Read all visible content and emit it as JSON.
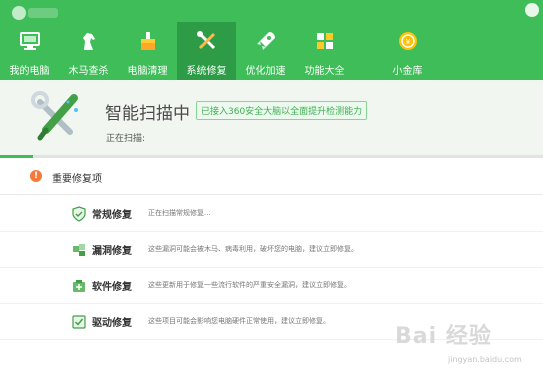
{
  "colors": {
    "accent": "#3fbd58",
    "active_tab": "#2e9c46",
    "warning": "#f27a3a"
  },
  "nav": {
    "items": [
      {
        "label": "我的电脑",
        "icon": "monitor-icon"
      },
      {
        "label": "木马查杀",
        "icon": "horse-icon"
      },
      {
        "label": "电脑清理",
        "icon": "broom-icon"
      },
      {
        "label": "系统修复",
        "icon": "wrench-screwdriver-icon",
        "active": true
      },
      {
        "label": "优化加速",
        "icon": "rocket-icon"
      },
      {
        "label": "功能大全",
        "icon": "grid-icon"
      },
      {
        "label": "小金库",
        "icon": "coin-icon"
      }
    ]
  },
  "scan": {
    "title": "智能扫描中",
    "badge": "已接入360安全大脑以全面提升检测能力",
    "status": "正在扫描:",
    "progress": 0.06
  },
  "section": {
    "title": "重要修复项"
  },
  "rows": [
    {
      "title": "常规修复",
      "desc": "正在扫描常规修复...",
      "icon": "shield-check-icon"
    },
    {
      "title": "漏洞修复",
      "desc": "这些漏洞可能会被木马、病毒利用，破坏您的电脑，建议立即修复。",
      "icon": "patch-icon"
    },
    {
      "title": "软件修复",
      "desc": "这些更新用于修复一些流行软件的严重安全漏洞，建议立即修复。",
      "icon": "software-icon"
    },
    {
      "title": "驱动修复",
      "desc": "这些项目可能会影响您电脑硬件正常使用，建议立即修复。",
      "icon": "driver-icon"
    }
  ],
  "watermark": {
    "brand": "Bai 经验",
    "site": "jingyan.baidu.com"
  }
}
